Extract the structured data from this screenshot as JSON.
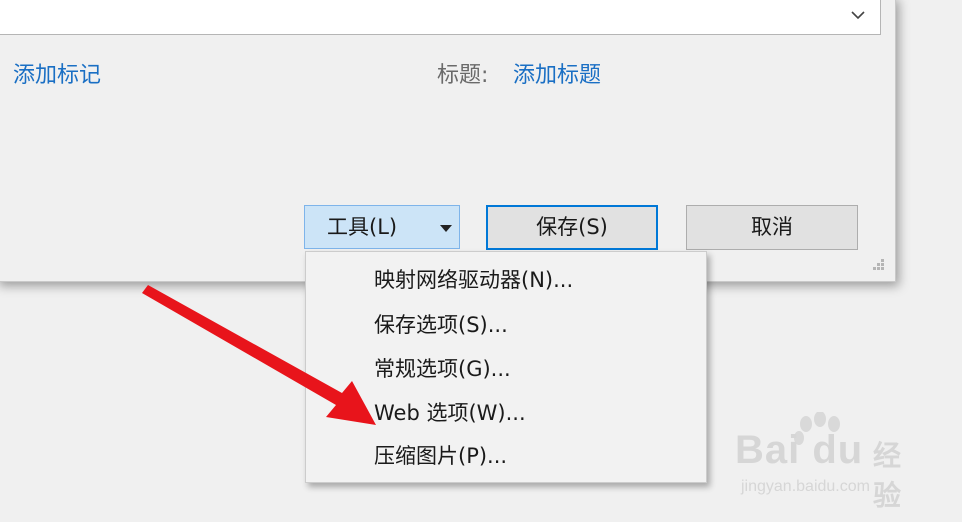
{
  "dialog": {
    "add_tag_link": "添加标记",
    "title_label": "标题:",
    "add_title_link": "添加标题",
    "tools_button": "工具(L)",
    "save_button": "保存(S)",
    "cancel_button": "取消"
  },
  "tools_menu": {
    "items": [
      {
        "label": "映射网络驱动器(N)..."
      },
      {
        "label": "保存选项(S)..."
      },
      {
        "label": "常规选项(G)..."
      },
      {
        "label": "Web 选项(W)..."
      },
      {
        "label": "压缩图片(P)..."
      }
    ]
  },
  "annotation": {
    "arrow_color": "#e8141b"
  },
  "watermark": {
    "brand": "Bai du",
    "brand_cn": "经验",
    "url": "jingyan.baidu.com"
  },
  "colors": {
    "link": "#1a6fc4",
    "focus_border": "#0078d7",
    "tools_bg": "#cce4f7"
  }
}
